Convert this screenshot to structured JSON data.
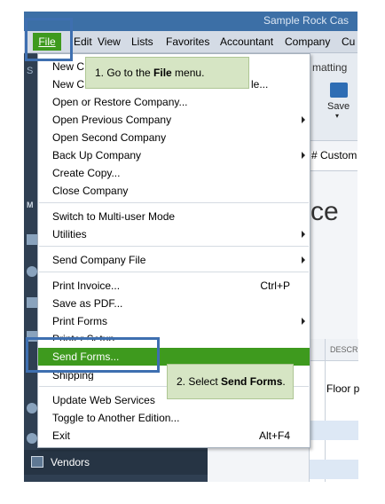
{
  "window": {
    "title": "Sample Rock Cas"
  },
  "menubar": {
    "items": [
      "File",
      "Edit",
      "View",
      "Lists",
      "Favorites",
      "Accountant",
      "Company",
      "Cu"
    ]
  },
  "file_menu": {
    "items": [
      {
        "label": "New Company...",
        "visible": "New C"
      },
      {
        "label": "New Company from Existing Company File...",
        "visible": "New C",
        "tail": "le..."
      },
      {
        "label": "Open or Restore Company..."
      },
      {
        "label": "Open Previous Company",
        "submenu": true
      },
      {
        "label": "Open Second Company"
      },
      {
        "label": "Back Up Company",
        "submenu": true
      },
      {
        "label": "Create Copy..."
      },
      {
        "label": "Close Company"
      },
      {
        "label": "Switch to Multi-user Mode"
      },
      {
        "label": "Utilities",
        "submenu": true
      },
      {
        "label": "Send Company File",
        "submenu": true
      },
      {
        "label": "Print Invoice...",
        "shortcut": "Ctrl+P"
      },
      {
        "label": "Save as PDF..."
      },
      {
        "label": "Print Forms",
        "submenu": true
      },
      {
        "label": "Printer Setup..."
      },
      {
        "label": "Send Forms...",
        "highlighted": true
      },
      {
        "label": "Shipping"
      },
      {
        "label": "Update Web Services"
      },
      {
        "label": "Toggle to Another Edition..."
      },
      {
        "label": "Exit",
        "shortcut": "Alt+F4"
      }
    ]
  },
  "callouts": {
    "step1": {
      "prefix": "1. Go to the ",
      "bold": "File",
      "suffix": " menu."
    },
    "step2": {
      "prefix": "2. Select ",
      "bold": "Send Forms",
      "suffix": "."
    }
  },
  "right_panel": {
    "tab": "matting",
    "save_label": "Save",
    "customer_label": "# Custom",
    "heading_fragment": "ce",
    "column_header": "DESCR",
    "row_text": "Floor p"
  },
  "left_nav": {
    "vendors_label": "Vendors",
    "letters": [
      "S",
      "M"
    ]
  },
  "colors": {
    "accent_green": "#3e9a1e",
    "callout_bg": "#d6e5c4",
    "highlight_border": "#3e6fb0",
    "nav_bg": "#2f3f52"
  }
}
